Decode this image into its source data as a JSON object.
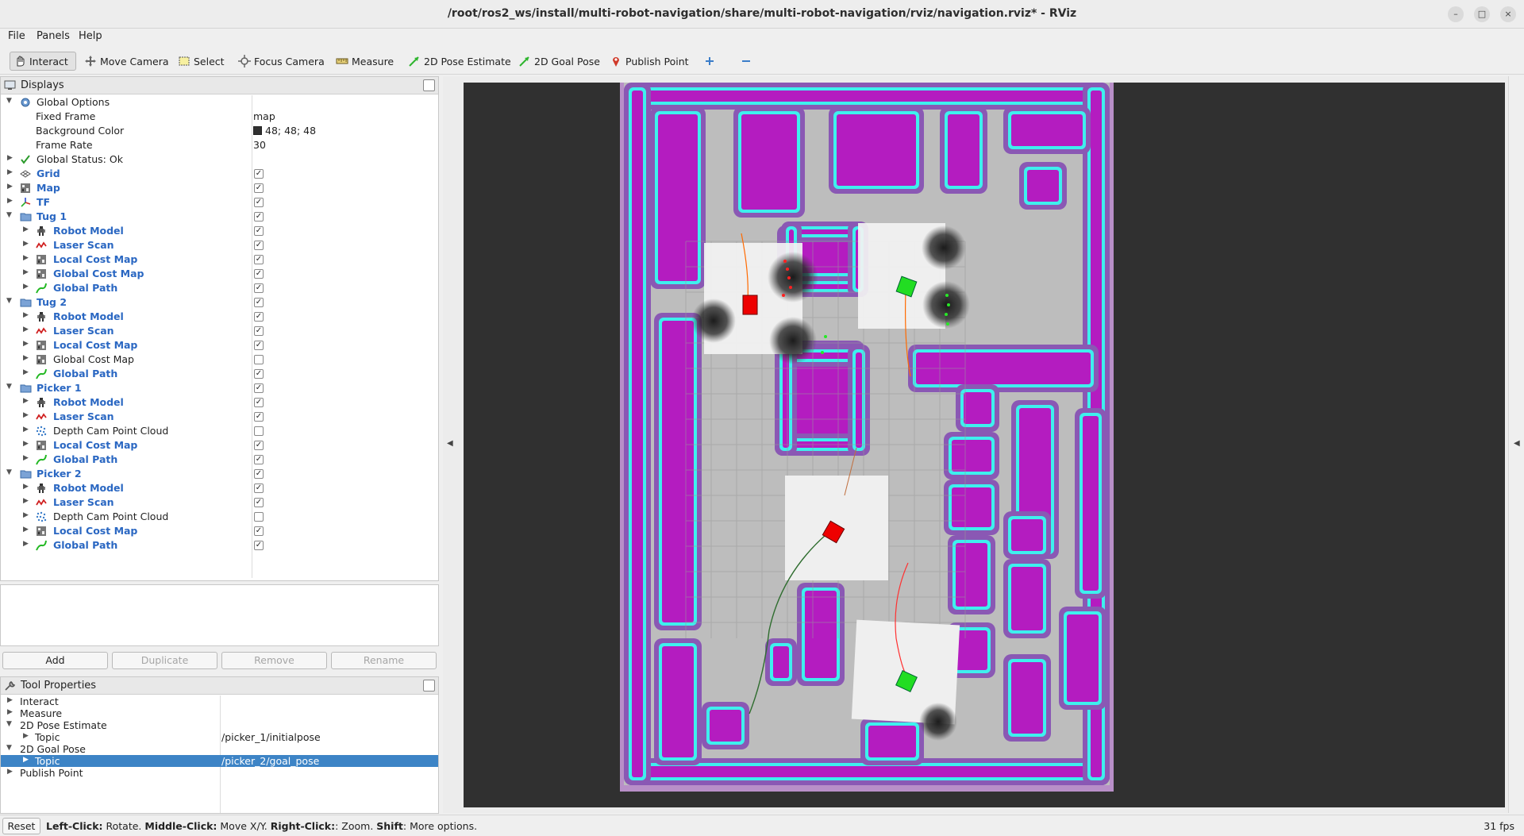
{
  "window": {
    "title": "/root/ros2_ws/install/multi-robot-navigation/share/multi-robot-navigation/rviz/navigation.rviz* - RViz",
    "buttons": [
      "minimize",
      "restore",
      "close"
    ]
  },
  "menu": {
    "file": "File",
    "panels": "Panels",
    "help": "Help"
  },
  "toolbar": {
    "interact": "Interact",
    "move_camera": "Move Camera",
    "select": "Select",
    "focus_camera": "Focus Camera",
    "measure": "Measure",
    "pose_estimate": "2D Pose Estimate",
    "goal_pose": "2D Goal Pose",
    "publish_point": "Publish Point"
  },
  "displays": {
    "header": "Displays",
    "global_options": "Global Options",
    "fixed_frame_label": "Fixed Frame",
    "fixed_frame_value": "map",
    "bg_color_label": "Background Color",
    "bg_color_value": "48; 48; 48",
    "bg_color_hex": "#303030",
    "frame_rate_label": "Frame Rate",
    "frame_rate_value": "30",
    "global_status": "Global Status: Ok",
    "grid": "Grid",
    "map": "Map",
    "tf": "TF",
    "groups": [
      {
        "name": "Tug 1",
        "items": [
          {
            "label": "Robot Model",
            "checked": true,
            "bold": true,
            "icon": "robot-model-icon"
          },
          {
            "label": "Laser Scan",
            "checked": true,
            "bold": true,
            "icon": "laser-scan-icon"
          },
          {
            "label": "Local Cost Map",
            "checked": true,
            "bold": true,
            "icon": "map-icon"
          },
          {
            "label": "Global Cost Map",
            "checked": true,
            "bold": true,
            "icon": "map-icon"
          },
          {
            "label": "Global Path",
            "checked": true,
            "bold": true,
            "icon": "path-icon"
          }
        ]
      },
      {
        "name": "Tug 2",
        "items": [
          {
            "label": "Robot Model",
            "checked": true,
            "bold": true,
            "icon": "robot-model-icon"
          },
          {
            "label": "Laser Scan",
            "checked": true,
            "bold": true,
            "icon": "laser-scan-icon"
          },
          {
            "label": "Local Cost Map",
            "checked": true,
            "bold": true,
            "icon": "map-icon"
          },
          {
            "label": "Global Cost Map",
            "checked": false,
            "bold": false,
            "icon": "map-icon"
          },
          {
            "label": "Global Path",
            "checked": true,
            "bold": true,
            "icon": "path-icon"
          }
        ]
      },
      {
        "name": "Picker 1",
        "items": [
          {
            "label": "Robot Model",
            "checked": true,
            "bold": true,
            "icon": "robot-model-icon"
          },
          {
            "label": "Laser Scan",
            "checked": true,
            "bold": true,
            "icon": "laser-scan-icon"
          },
          {
            "label": "Depth Cam Point Cloud",
            "checked": false,
            "bold": false,
            "icon": "point-cloud-icon"
          },
          {
            "label": "Local Cost Map",
            "checked": true,
            "bold": true,
            "icon": "map-icon"
          },
          {
            "label": "Global Path",
            "checked": true,
            "bold": true,
            "icon": "path-icon"
          }
        ]
      },
      {
        "name": "Picker 2",
        "items": [
          {
            "label": "Robot Model",
            "checked": true,
            "bold": true,
            "icon": "robot-model-icon"
          },
          {
            "label": "Laser Scan",
            "checked": true,
            "bold": true,
            "icon": "laser-scan-icon"
          },
          {
            "label": "Depth Cam Point Cloud",
            "checked": false,
            "bold": false,
            "icon": "point-cloud-icon"
          },
          {
            "label": "Local Cost Map",
            "checked": true,
            "bold": true,
            "icon": "map-icon"
          },
          {
            "label": "Global Path",
            "checked": true,
            "bold": true,
            "icon": "path-icon"
          }
        ]
      }
    ]
  },
  "buttons": {
    "add": "Add",
    "duplicate": "Duplicate",
    "remove": "Remove",
    "rename": "Rename"
  },
  "tool_properties": {
    "header": "Tool Properties",
    "interact": "Interact",
    "measure": "Measure",
    "pose_estimate": "2D Pose Estimate",
    "pose_topic_label": "Topic",
    "pose_topic_value": "/picker_1/initialpose",
    "goal_pose": "2D Goal Pose",
    "goal_topic_label": "Topic",
    "goal_topic_value": "/picker_2/goal_pose",
    "publish_point": "Publish Point"
  },
  "status": {
    "reset": "Reset",
    "left_click": "Left-Click:",
    "left_desc": " Rotate. ",
    "middle_click": "Middle-Click:",
    "middle_desc": " Move X/Y. ",
    "right_click": "Right-Click:",
    "right_desc": ": Zoom. ",
    "shift": "Shift",
    "shift_desc": ": More options.",
    "fps": "31 fps"
  },
  "colors": {
    "checkbox_blue": "#2a67c2",
    "selection": "#3d84c6",
    "costmap_cyan": "#3ef0ee",
    "costmap_magenta": "#b41cc0",
    "costmap_purple": "#8a58b4",
    "robot_red": "#ee0000",
    "robot_green": "#22dd22"
  }
}
